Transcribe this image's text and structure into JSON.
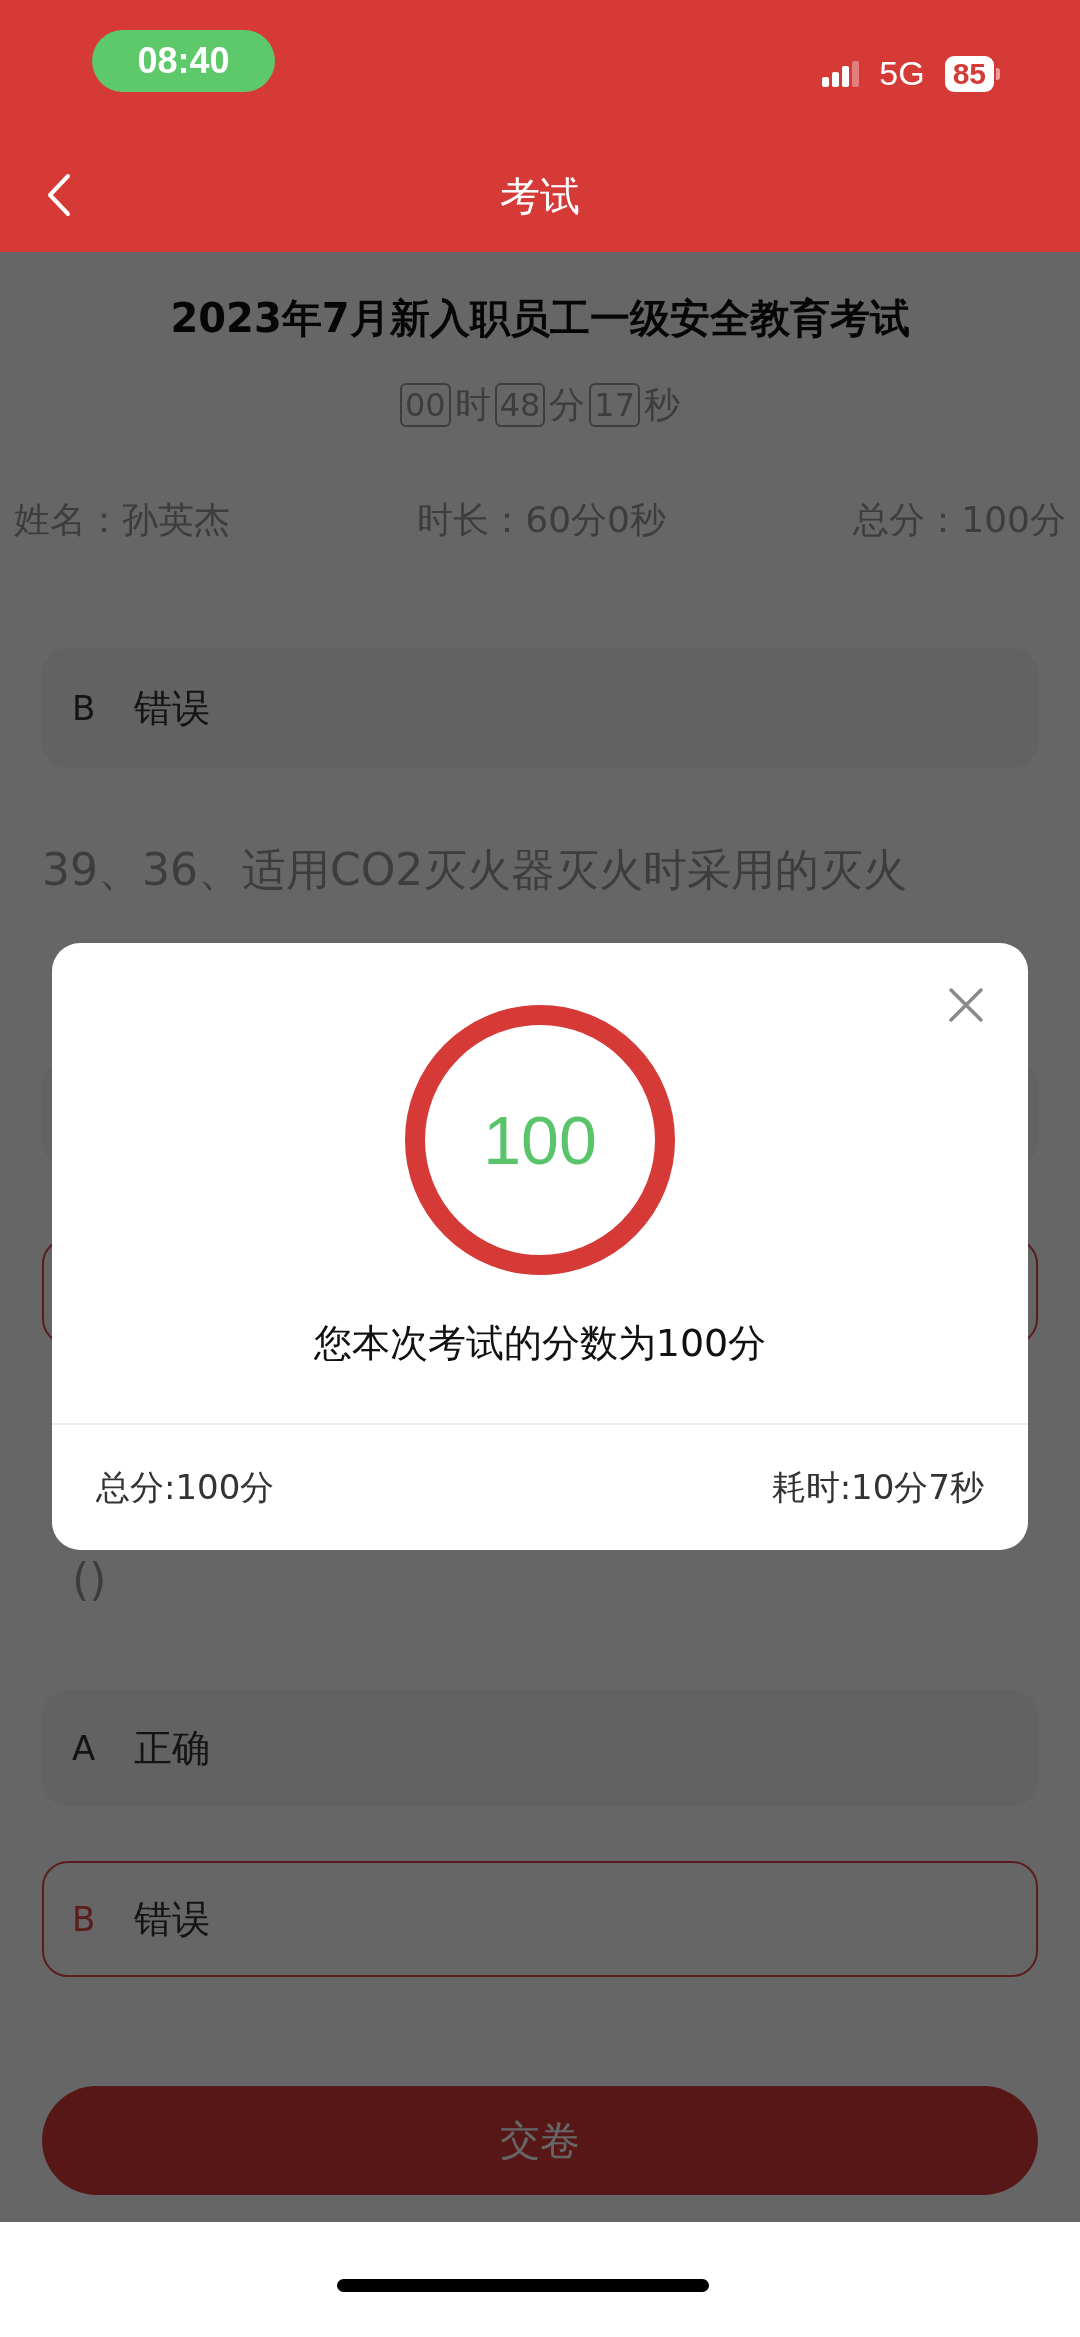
{
  "status_bar": {
    "time": "08:40",
    "network": "5G",
    "battery": "85"
  },
  "header": {
    "title": "考试"
  },
  "exam": {
    "title": "2023年7月新入职员工一级安全教育考试",
    "timer": [
      {
        "value": "00",
        "unit": "时"
      },
      {
        "value": "48",
        "unit": "分"
      },
      {
        "value": "17",
        "unit": "秒"
      }
    ],
    "info": [
      "姓名：孙英杰",
      "时长：60分0秒",
      "总分：100分"
    ]
  },
  "items": [
    {
      "kind": "option",
      "letter": "B",
      "text": "错误",
      "selected": false
    },
    {
      "kind": "question",
      "text": "39、36、适用CO2灭火器灭火时采用的灭火"
    },
    {
      "kind": "blank",
      "selected": false
    },
    {
      "kind": "blank",
      "selected": true
    },
    {
      "kind": "question",
      "text": "()"
    },
    {
      "kind": "option",
      "letter": "A",
      "text": "正确",
      "selected": false
    },
    {
      "kind": "option",
      "letter": "B",
      "text": "错误",
      "selected": true
    }
  ],
  "submit_button": {
    "label": "交卷"
  },
  "result_dialog": {
    "score": "100",
    "message": "您本次考试的分数为100分",
    "total": "总分:100分",
    "duration": "耗时:10分7秒"
  }
}
